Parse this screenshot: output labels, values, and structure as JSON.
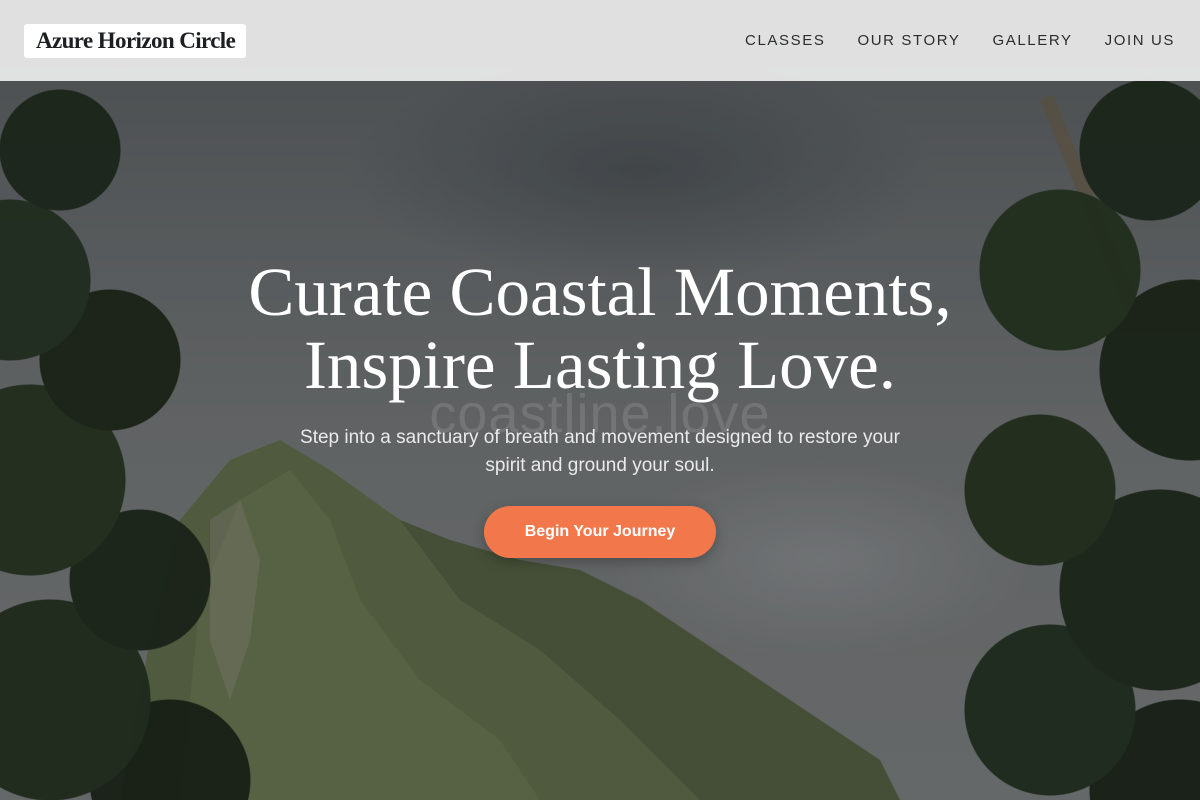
{
  "site": {
    "logo_text": "Azure Horizon Circle"
  },
  "nav": {
    "items": [
      {
        "label": "CLASSES"
      },
      {
        "label": "OUR STORY"
      },
      {
        "label": "GALLERY"
      },
      {
        "label": "JOIN US"
      }
    ]
  },
  "hero": {
    "headline_line1": "Curate Coastal Moments,",
    "headline_line2": "Inspire Lasting Love.",
    "watermark": "coastline.love",
    "subtext_line1": "Step into a sanctuary of breath and movement designed to restore your",
    "subtext_line2": "spirit and ground your soul.",
    "cta_label": "Begin Your Journey"
  },
  "colors": {
    "accent": "#f2784b",
    "header_bg": "#ececec",
    "logo_text": "#1d1f22"
  }
}
